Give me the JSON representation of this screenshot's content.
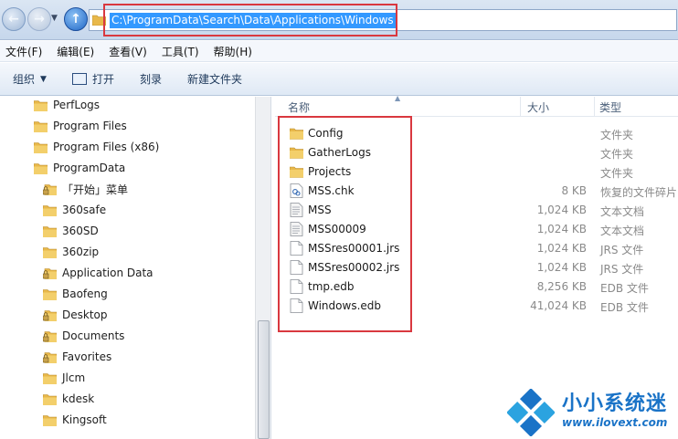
{
  "address": {
    "path": "C:\\ProgramData\\Search\\Data\\Applications\\Windows"
  },
  "menu": [
    "文件(F)",
    "编辑(E)",
    "查看(V)",
    "工具(T)",
    "帮助(H)"
  ],
  "toolbar": {
    "organize": "组织",
    "open": "打开",
    "burn": "刻录",
    "new_folder": "新建文件夹"
  },
  "tree": [
    {
      "label": "PerfLogs",
      "locked": false
    },
    {
      "label": "Program Files",
      "locked": false
    },
    {
      "label": "Program Files (x86)",
      "locked": false
    },
    {
      "label": "ProgramData",
      "locked": false
    },
    {
      "label": "「开始」菜单",
      "locked": true
    },
    {
      "label": "360safe",
      "locked": false
    },
    {
      "label": "360SD",
      "locked": false
    },
    {
      "label": "360zip",
      "locked": false
    },
    {
      "label": "Application Data",
      "locked": true
    },
    {
      "label": "Baofeng",
      "locked": false
    },
    {
      "label": "Desktop",
      "locked": true
    },
    {
      "label": "Documents",
      "locked": true
    },
    {
      "label": "Favorites",
      "locked": true
    },
    {
      "label": "Jlcm",
      "locked": false
    },
    {
      "label": "kdesk",
      "locked": false
    },
    {
      "label": "Kingsoft",
      "locked": false
    }
  ],
  "columns": {
    "name": "名称",
    "size": "大小",
    "type": "类型"
  },
  "files": [
    {
      "name": "Config",
      "size": "",
      "type": "文件夹",
      "icon": "folder"
    },
    {
      "name": "GatherLogs",
      "size": "",
      "type": "文件夹",
      "icon": "folder"
    },
    {
      "name": "Projects",
      "size": "",
      "type": "文件夹",
      "icon": "folder"
    },
    {
      "name": "MSS.chk",
      "size": "8 KB",
      "type": "恢复的文件碎片",
      "icon": "chk"
    },
    {
      "name": "MSS",
      "size": "1,024 KB",
      "type": "文本文档",
      "icon": "text"
    },
    {
      "name": "MSS00009",
      "size": "1,024 KB",
      "type": "文本文档",
      "icon": "text"
    },
    {
      "name": "MSSres00001.jrs",
      "size": "1,024 KB",
      "type": "JRS 文件",
      "icon": "file"
    },
    {
      "name": "MSSres00002.jrs",
      "size": "1,024 KB",
      "type": "JRS 文件",
      "icon": "file"
    },
    {
      "name": "tmp.edb",
      "size": "8,256 KB",
      "type": "EDB 文件",
      "icon": "file"
    },
    {
      "name": "Windows.edb",
      "size": "41,024 KB",
      "type": "EDB 文件",
      "icon": "file"
    }
  ],
  "watermark": {
    "text": "小小系统迷",
    "url": "www.ilovext.com"
  },
  "colors": {
    "highlight": "#d9383f",
    "selection": "#3399ff",
    "folder": "#e8b84a"
  }
}
